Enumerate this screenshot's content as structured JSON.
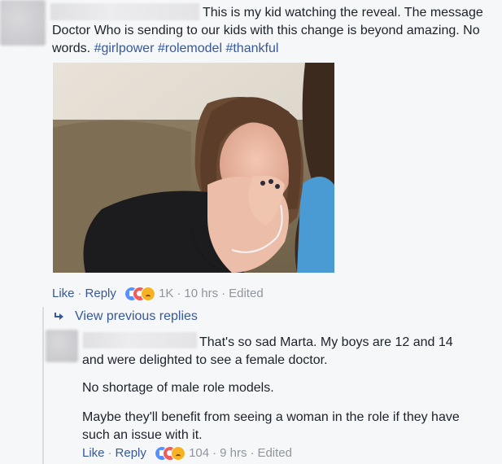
{
  "post": {
    "text": "This is my kid watching the reveal. The message",
    "text_line2": "Doctor Who is sending to our kids with this change is beyond amazing. No",
    "text_line3_prefix": "words. ",
    "hashtags": [
      "#girlpower",
      "#rolemodel",
      "#thankful"
    ],
    "actions": {
      "like": "Like",
      "reply": "Reply",
      "reaction_count": "1K",
      "time": "10 hrs",
      "edited": "Edited"
    }
  },
  "replies": {
    "view_previous": "View previous replies"
  },
  "reply": {
    "line1": "That's so sad Marta. My boys are 12 and 14",
    "line2": "and were delighted to see a female doctor.",
    "para2": "No shortage of male role models.",
    "para3_line1": "Maybe they'll benefit from seeing a woman in the role if they have",
    "para3_line2": "such an issue with it.",
    "actions": {
      "like": "Like",
      "reply": "Reply",
      "reaction_count": "104",
      "time": "9 hrs",
      "edited": "Edited"
    }
  },
  "colors": {
    "link": "#365899",
    "meta": "#90949c",
    "background": "#f6f7f9"
  },
  "icons": [
    "reply-arrow-icon",
    "like-reaction-icon",
    "wow-reaction-icon",
    "sad-reaction-icon"
  ]
}
